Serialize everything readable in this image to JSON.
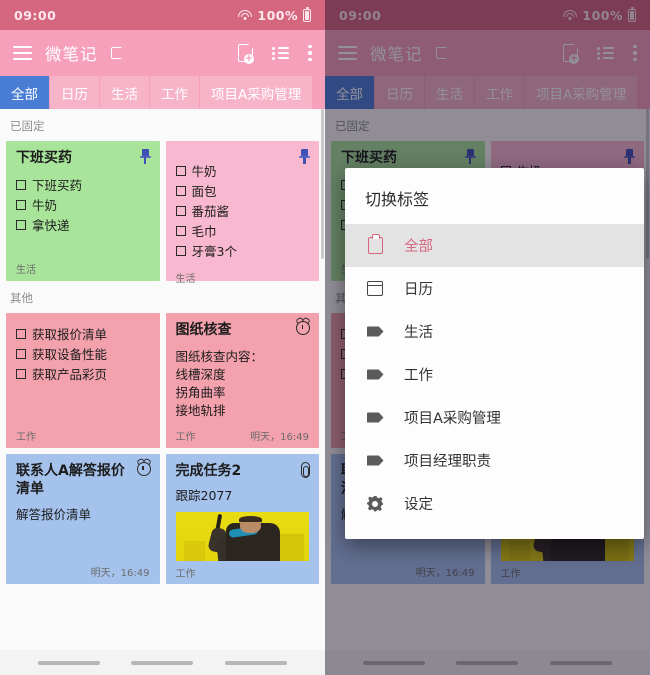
{
  "status_bar": {
    "time": "09:00",
    "battery": "100%",
    "wifi_icon": "wifi-icon",
    "battery_icon": "battery-icon"
  },
  "app_bar": {
    "menu_icon": "hamburger-icon",
    "title": "微笔记",
    "tag_icon": "tag-icon",
    "new_note_icon": "new-note-icon",
    "list_view_icon": "list-view-icon",
    "more_icon": "more-vert-icon"
  },
  "tabs": [
    {
      "label": "全部",
      "active": true
    },
    {
      "label": "日历",
      "active": false
    },
    {
      "label": "生活",
      "active": false
    },
    {
      "label": "工作",
      "active": false
    },
    {
      "label": "项目A采购管理",
      "active": false
    }
  ],
  "sections": {
    "pinned_label": "已固定",
    "other_label": "其他"
  },
  "cards": {
    "pinned": [
      {
        "title": "下班买药",
        "checklist": [
          "下班买药",
          "牛奶",
          "拿快递"
        ],
        "tag": "生活",
        "date": "",
        "corner_icon": "pin-icon",
        "color": "#a8e49a"
      },
      {
        "title": "",
        "checklist": [
          "牛奶",
          "面包",
          "番茄酱",
          "毛巾",
          "牙膏3个"
        ],
        "tag": "生活",
        "date": "",
        "corner_icon": "pin-icon",
        "color": "#f8b8d0"
      }
    ],
    "other": [
      {
        "title": "",
        "checklist": [
          "获取报价清单",
          "获取设备性能",
          "获取产品彩页"
        ],
        "tag": "工作",
        "date": "",
        "corner_icon": "",
        "color": "#f2a1ad"
      },
      {
        "title": "图纸核查",
        "body": "图纸核查内容：\n线槽深度\n拐角曲率\n接地轨排",
        "tag": "工作",
        "date": "明天，16:49",
        "corner_icon": "alarm-icon",
        "color": "#f2a1ad"
      },
      {
        "title": "联系人A解答报价清单",
        "body": "解答报价清单",
        "tag": "",
        "date": "明天，16:49",
        "corner_icon": "alarm-icon",
        "color": "#a4c2ec"
      },
      {
        "title": "完成任务2",
        "body": "跟踪2077",
        "tag": "工作",
        "date": "",
        "corner_icon": "attachment-icon",
        "has_thumbnail": true,
        "color": "#a4c2ec"
      }
    ]
  },
  "dialog": {
    "title": "切换标签",
    "items": [
      {
        "label": "全部",
        "icon": "clipboard-icon",
        "selected": true
      },
      {
        "label": "日历",
        "icon": "calendar-icon",
        "selected": false
      },
      {
        "label": "生活",
        "icon": "tag-icon",
        "selected": false
      },
      {
        "label": "工作",
        "icon": "tag-icon",
        "selected": false
      },
      {
        "label": "项目A采购管理",
        "icon": "tag-icon",
        "selected": false
      },
      {
        "label": "项目经理职责",
        "icon": "tag-icon",
        "selected": false
      },
      {
        "label": "设定",
        "icon": "gear-icon",
        "selected": false
      }
    ]
  },
  "colors": {
    "status_bar": "#d4677f",
    "app_bar": "#f6a0bb",
    "tab_inactive": "#f7b4c8",
    "tab_active": "#4a7ed4",
    "accent_selected": "#d4677f"
  }
}
